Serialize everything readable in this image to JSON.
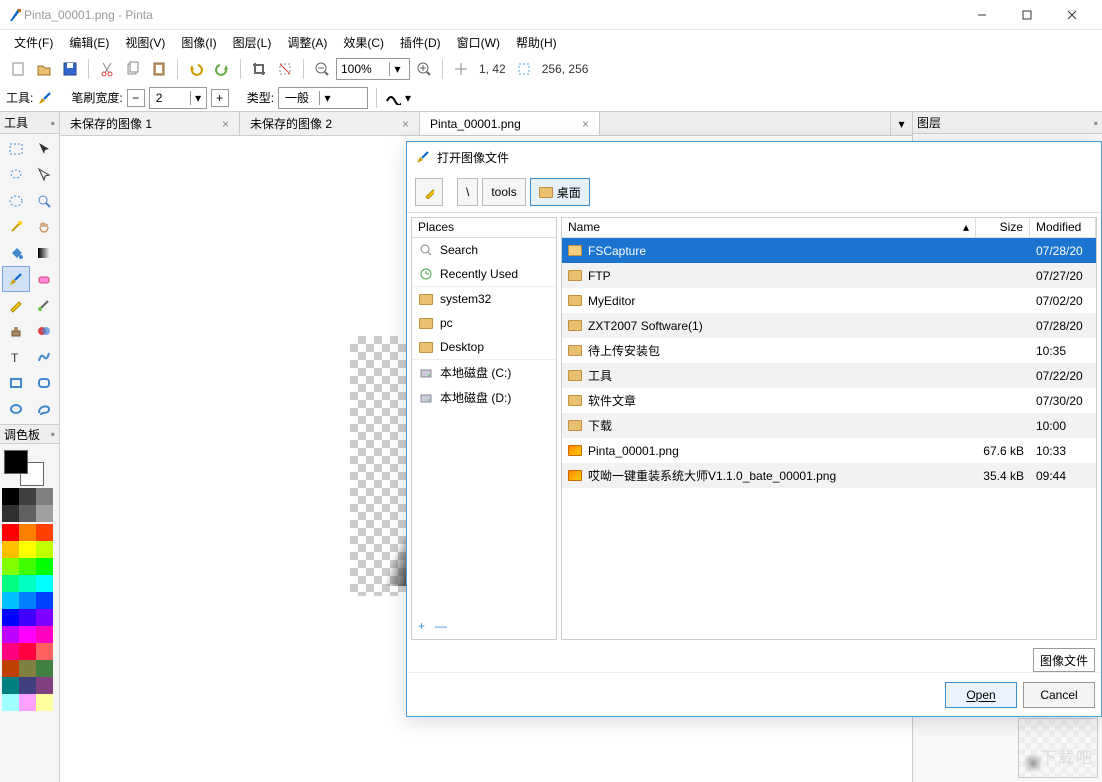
{
  "window": {
    "title": "Pinta_00001.png - Pinta"
  },
  "menu": {
    "file": "文件(F)",
    "edit": "编辑(E)",
    "view": "视图(V)",
    "image": "图像(I)",
    "layer": "图层(L)",
    "adjust": "调整(A)",
    "effect": "效果(C)",
    "addin": "插件(D)",
    "window": "窗口(W)",
    "help": "帮助(H)"
  },
  "toolbar": {
    "zoom_value": "100%",
    "cursor_pos": "1, 42",
    "canvas_size": "256, 256"
  },
  "toolopts": {
    "tool_label": "工具:",
    "brush_width_label": "笔刷宽度:",
    "brush_width_value": "2",
    "type_label": "类型:",
    "type_value": "一般"
  },
  "panels": {
    "tools_title": "工具",
    "palette_title": "调色板",
    "layers_title": "图层"
  },
  "tabs": [
    {
      "label": "未保存的图像 1",
      "active": false
    },
    {
      "label": "未保存的图像 2",
      "active": false
    },
    {
      "label": "Pinta_00001.png",
      "active": true
    }
  ],
  "dialog": {
    "title": "打开图像文件",
    "path": {
      "sep": "\\",
      "seg1": "tools",
      "seg2": "桌面"
    },
    "places_header": "Places",
    "places": [
      {
        "label": "Search",
        "icon": "search"
      },
      {
        "label": "Recently Used",
        "icon": "recent"
      },
      {
        "label": "system32",
        "icon": "folder"
      },
      {
        "label": "pc",
        "icon": "folder"
      },
      {
        "label": "Desktop",
        "icon": "folder"
      },
      {
        "label": "本地磁盘 (C:)",
        "icon": "disk"
      },
      {
        "label": "本地磁盘 (D:)",
        "icon": "disk"
      }
    ],
    "columns": {
      "name": "Name",
      "size": "Size",
      "modified": "Modified"
    },
    "files": [
      {
        "name": "FSCapture",
        "size": "",
        "modified": "07/28/20",
        "type": "folder",
        "selected": true
      },
      {
        "name": "FTP",
        "size": "",
        "modified": "07/27/20",
        "type": "folder"
      },
      {
        "name": "MyEditor",
        "size": "",
        "modified": "07/02/20",
        "type": "folder"
      },
      {
        "name": "ZXT2007 Software(1)",
        "size": "",
        "modified": "07/28/20",
        "type": "folder"
      },
      {
        "name": "待上传安装包",
        "size": "",
        "modified": "10:35",
        "type": "folder"
      },
      {
        "name": "工具",
        "size": "",
        "modified": "07/22/20",
        "type": "folder"
      },
      {
        "name": "软件文章",
        "size": "",
        "modified": "07/30/20",
        "type": "folder"
      },
      {
        "name": "下载",
        "size": "",
        "modified": "10:00",
        "type": "folder"
      },
      {
        "name": "Pinta_00001.png",
        "size": "67.6 kB",
        "modified": "10:33",
        "type": "image"
      },
      {
        "name": "哎呦一键重装系统大师V1.1.0_bate_00001.png",
        "size": "35.4 kB",
        "modified": "09:44",
        "type": "image"
      }
    ],
    "file_type": "图像文件",
    "open_label": "Open",
    "cancel_label": "Cancel"
  },
  "colors": {
    "grays": [
      "#000000",
      "#404040",
      "#808080",
      "#303030",
      "#606060",
      "#a0a0a0"
    ],
    "palette": [
      "#ff0000",
      "#ff8000",
      "#ff4000",
      "#ffc000",
      "#ffff00",
      "#c0ff00",
      "#80ff00",
      "#40ff00",
      "#00ff00",
      "#00ff80",
      "#00ffc0",
      "#00ffff",
      "#00c0ff",
      "#0080ff",
      "#0040ff",
      "#0000ff",
      "#4000ff",
      "#8000ff",
      "#c000ff",
      "#ff00ff",
      "#ff00c0",
      "#ff0080",
      "#ff0040",
      "#ff6060",
      "#c04000",
      "#808040",
      "#408040",
      "#008080",
      "#404080",
      "#804080",
      "#a0ffff",
      "#ffa0ff",
      "#ffffa0"
    ]
  },
  "watermark": "下载吧"
}
